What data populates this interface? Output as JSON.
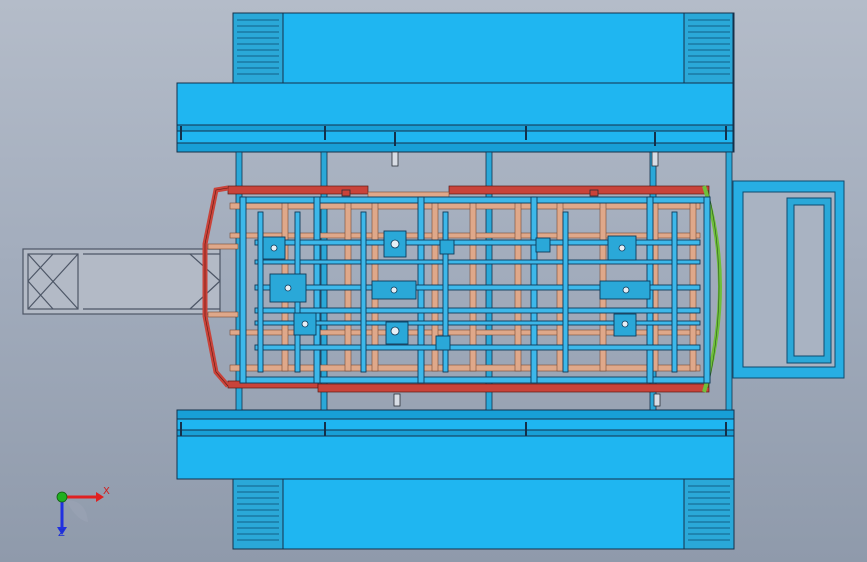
{
  "viewport": {
    "background_top": "#b4bcc9",
    "background_bottom": "#8f9aab"
  },
  "model": {
    "platform_fill": "#1fb6f1",
    "edge_color": "#14304a",
    "chassis_red": "#c9433a",
    "chassis_tan": "#dfa88a",
    "frame_blue": "#3db8ea",
    "arc_green": "#6fbf3a"
  },
  "triad": {
    "x_label": "X",
    "z_label": "Z",
    "x_color": "#e02020",
    "y_color": "#20b020",
    "z_color": "#2030e0",
    "icon": "axis-triad-icon"
  }
}
